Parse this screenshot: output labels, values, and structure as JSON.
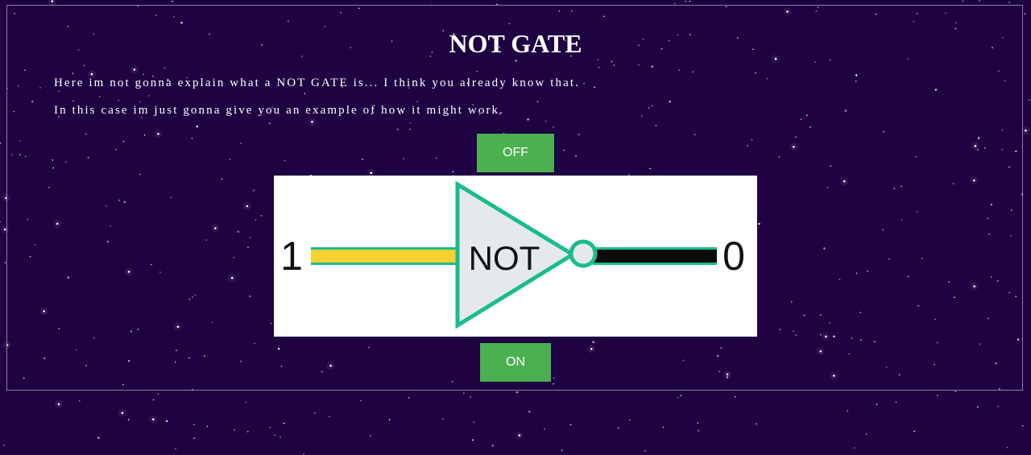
{
  "page": {
    "title": "NOT GATE",
    "intro_line_1": "Here im not gonna explain what a NOT GATE is... I think you already know that.",
    "intro_line_2": "In this case im just gonna give you an example of how it might work."
  },
  "controls": {
    "off_label": "OFF",
    "on_label": "ON"
  },
  "gate": {
    "input_value": "1",
    "gate_label": "NOT",
    "output_value": "0",
    "input_wire_state": "on",
    "output_wire_state": "off"
  },
  "colors": {
    "background": "#1f0242",
    "button": "#4caf50",
    "gate_outline": "#1abc8f",
    "gate_fill": "#e5e9ec",
    "wire_on": "#f9d232",
    "wire_off": "#0b0b0b"
  }
}
